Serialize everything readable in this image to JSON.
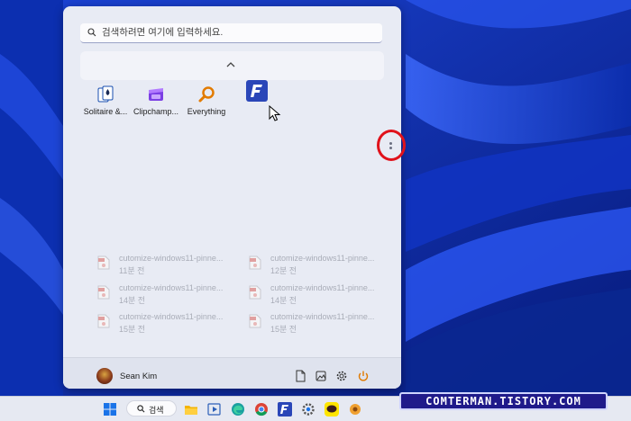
{
  "search": {
    "placeholder": "검색하려면 여기에 입력하세요."
  },
  "pinned": [
    {
      "label": "Solitaire &...",
      "icon": "solitaire-icon"
    },
    {
      "label": "Clipchamp...",
      "icon": "clipchamp-icon"
    },
    {
      "label": "Everything",
      "icon": "everything-icon"
    },
    {
      "label": "",
      "icon": "f-app-icon"
    }
  ],
  "recent": [
    {
      "name": "cutomize-windows11-pinne...",
      "time": "11분 전"
    },
    {
      "name": "cutomize-windows11-pinne...",
      "time": "12분 전"
    },
    {
      "name": "cutomize-windows11-pinne...",
      "time": "14분 전"
    },
    {
      "name": "cutomize-windows11-pinne...",
      "time": "14분 전"
    },
    {
      "name": "cutomize-windows11-pinne...",
      "time": "15분 전"
    },
    {
      "name": "cutomize-windows11-pinne...",
      "time": "15분 전"
    }
  ],
  "user": {
    "name": "Sean Kim"
  },
  "taskbar": {
    "search_label": "검색"
  },
  "watermark": "COMTERMAN.TISTORY.COM",
  "colors": {
    "accent": "#0a2a9a",
    "highlight_circle": "#e0121b",
    "watermark_bg": "#1f1a8a"
  }
}
